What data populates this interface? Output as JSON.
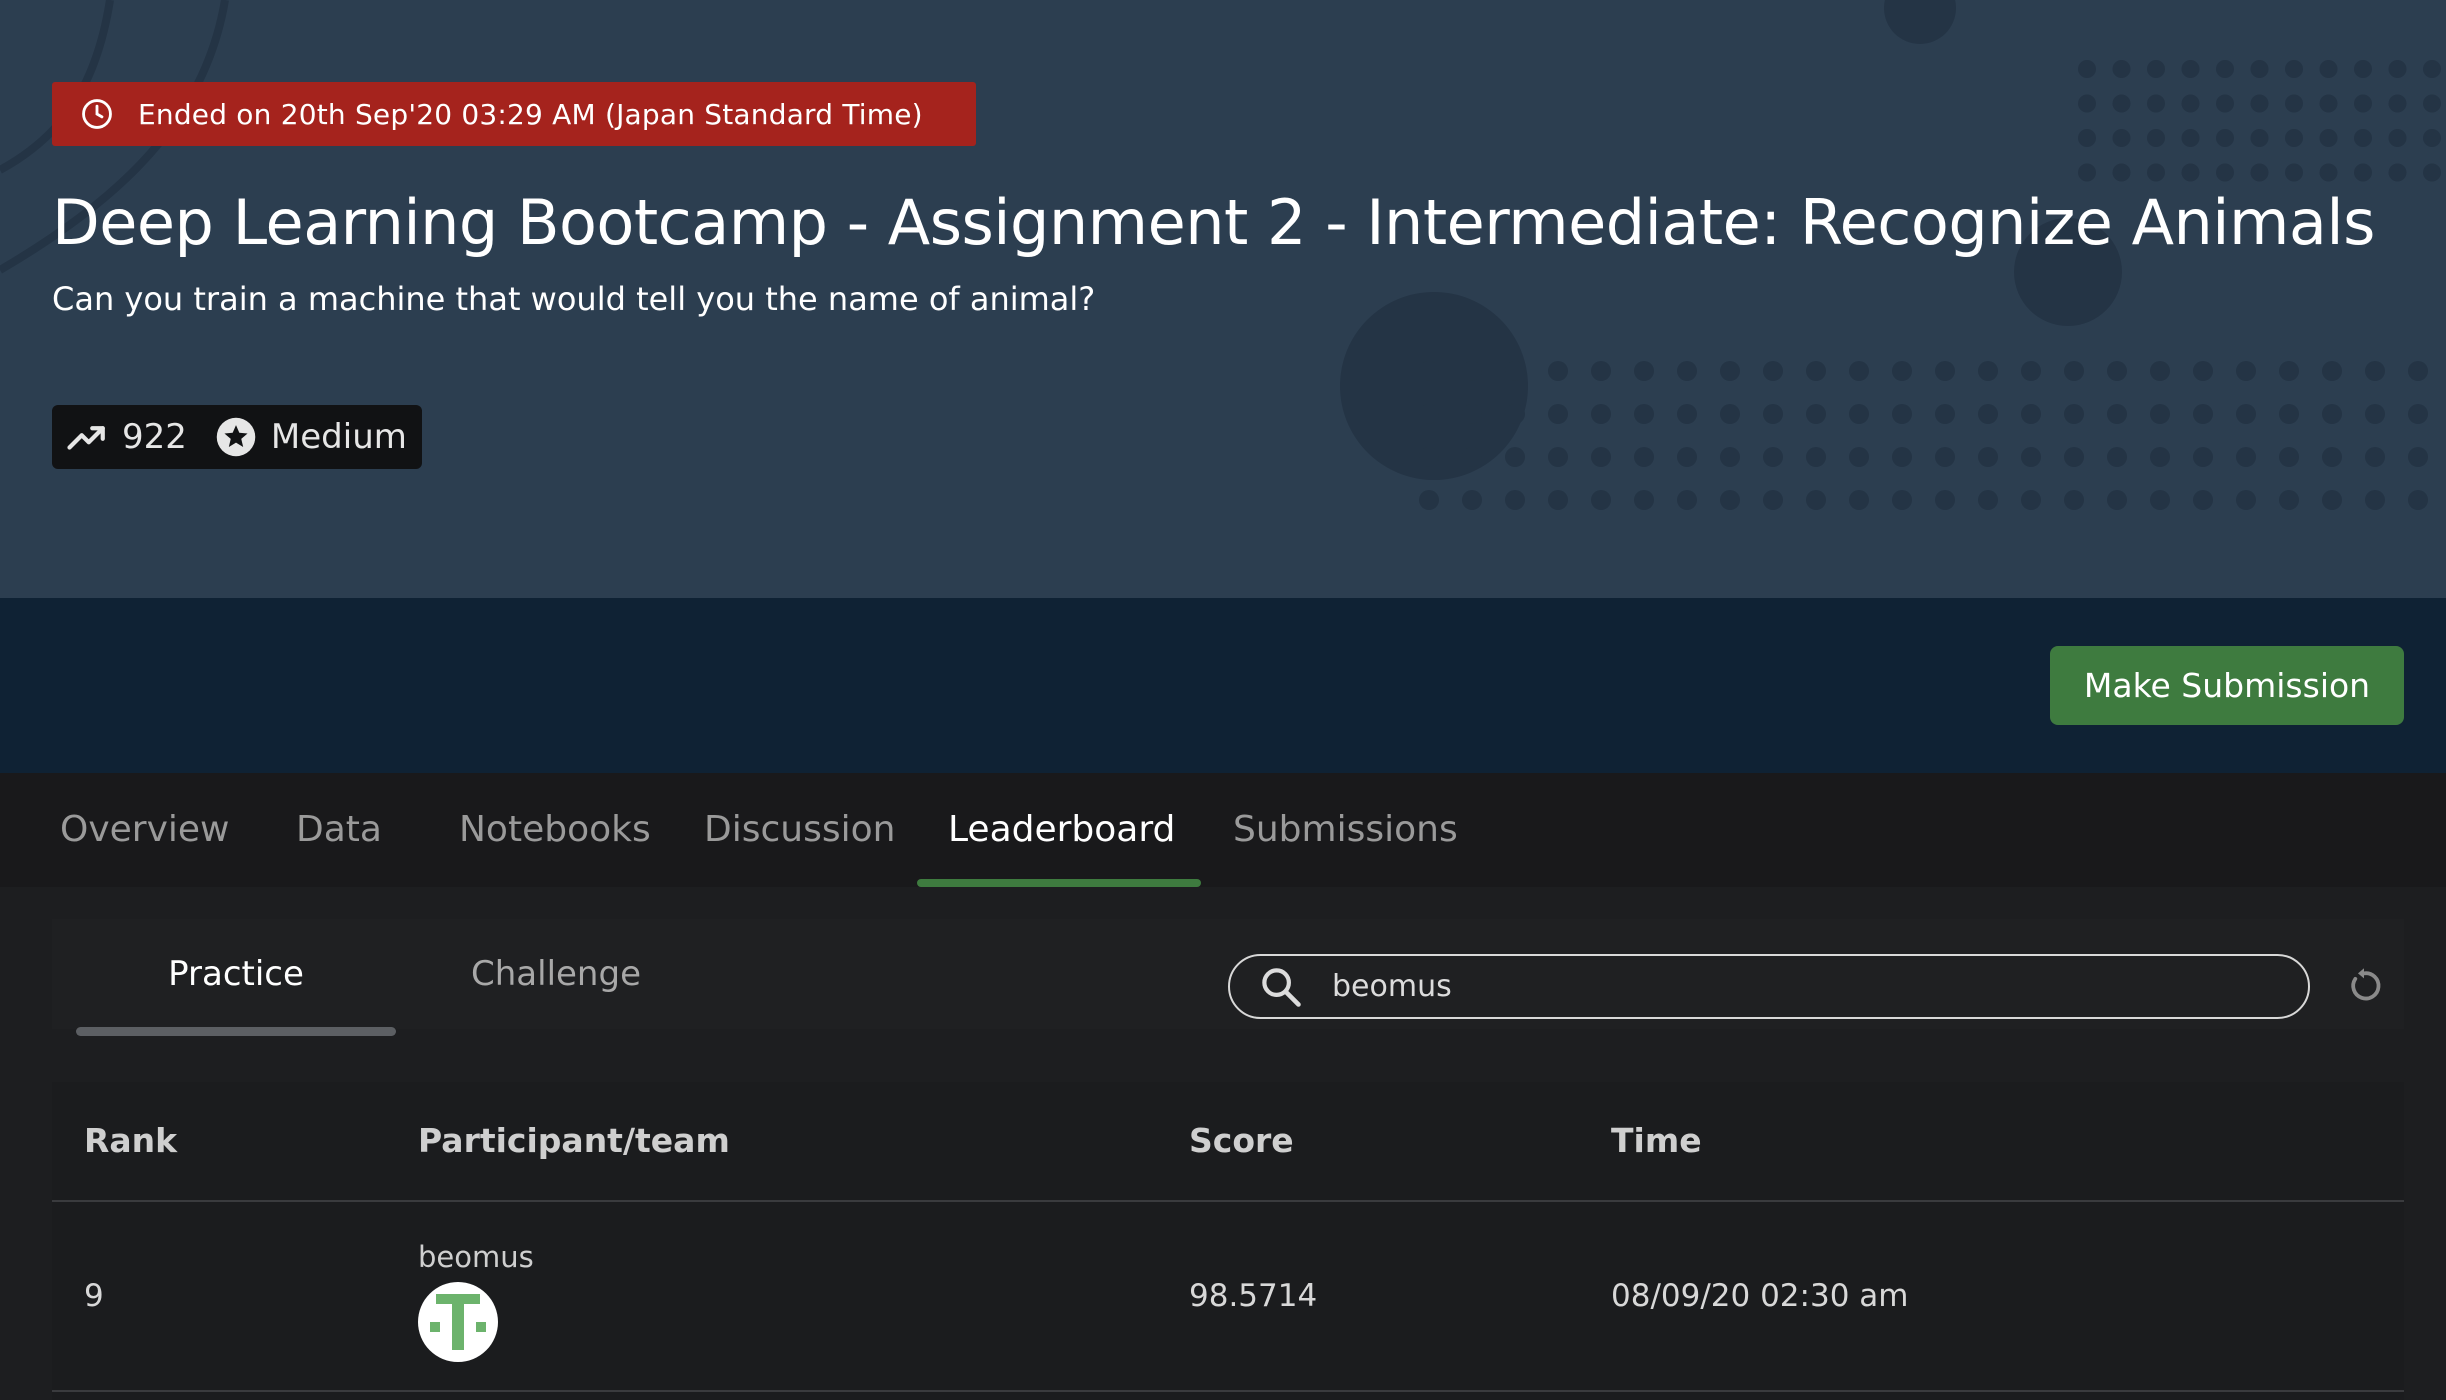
{
  "hero": {
    "ended_text": "Ended on 20th Sep'20 03:29 AM (Japan Standard Time)",
    "title": "Deep Learning Bootcamp - Assignment 2 - Intermediate: Recognize Animals",
    "subtitle": "Can you train a machine that would tell you the name of animal?",
    "stats": {
      "count": "922",
      "difficulty": "Medium",
      "count_icon": "trending-up-icon",
      "difficulty_icon": "star-badge-icon"
    },
    "colors": {
      "background": "#2c3e50",
      "banner": "#a5231d"
    }
  },
  "action_bar": {
    "make_submission_label": "Make Submission",
    "accent": "#3e7b3f"
  },
  "tabs": [
    {
      "label": "Overview",
      "active": false
    },
    {
      "label": "Data",
      "active": false
    },
    {
      "label": "Notebooks",
      "active": false
    },
    {
      "label": "Discussion",
      "active": false
    },
    {
      "label": "Leaderboard",
      "active": true
    },
    {
      "label": "Submissions",
      "active": false
    }
  ],
  "leaderboard": {
    "subtabs": [
      {
        "label": "Practice",
        "active": true
      },
      {
        "label": "Challenge",
        "active": false
      }
    ],
    "search": {
      "value": "beomus",
      "icon": "search-icon"
    },
    "refresh_icon": "refresh-icon",
    "columns": [
      "Rank",
      "Participant/team",
      "Score",
      "Time"
    ],
    "rows": [
      {
        "rank": "9",
        "participant": "beomus",
        "score": "98.5714",
        "time": "08/09/20 02:30 am"
      }
    ]
  }
}
